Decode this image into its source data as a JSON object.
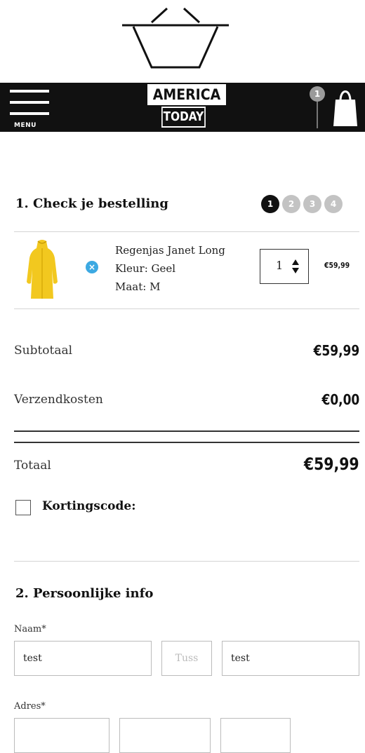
{
  "header": {
    "menu_label": "MENU",
    "logo_line1": "AMERICA",
    "logo_line2": "TODAY",
    "cart_count": "1"
  },
  "order_section": {
    "title": "1. Check je bestelling",
    "steps": [
      {
        "label": "1",
        "active": true
      },
      {
        "label": "2",
        "active": false
      },
      {
        "label": "3",
        "active": false
      },
      {
        "label": "4",
        "active": false
      }
    ]
  },
  "product": {
    "name": "Regenjas Janet Long",
    "color": "Kleur: Geel",
    "size": "Maat: M",
    "quantity": "1",
    "price": "€59,99",
    "image_color": "#f2c81f"
  },
  "totals": {
    "subtotal_label": "Subtotaal",
    "subtotal_value": "€59,99",
    "shipping_label": "Verzendkosten",
    "shipping_value": "€0,00",
    "total_label": "Totaal",
    "total_value": "€59,99"
  },
  "discount": {
    "label": "Kortingscode:"
  },
  "personal": {
    "title": "2. Persoonlijke info",
    "name_label": "Naam*",
    "first_name_value": "test",
    "middle_placeholder": "Tuss",
    "last_name_value": "test",
    "address_label": "Adres*"
  },
  "icons": {
    "remove": "close-circle-icon",
    "accent": "#3ca9e2"
  }
}
